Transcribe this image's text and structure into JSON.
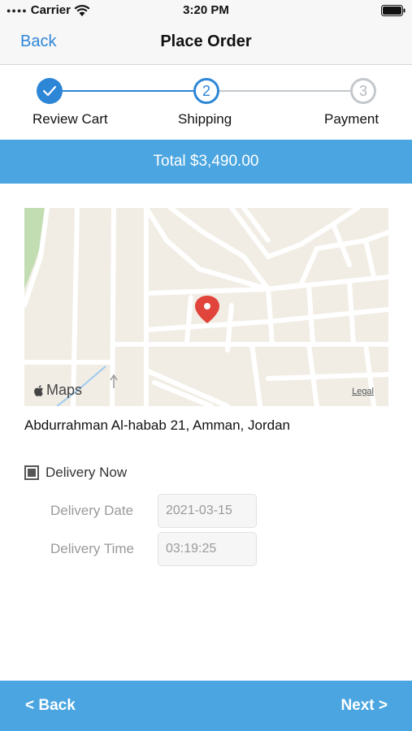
{
  "status_bar": {
    "carrier": "Carrier",
    "time": "3:20 PM"
  },
  "nav": {
    "back_label": "Back",
    "title": "Place Order"
  },
  "stepper": {
    "steps": [
      {
        "label": "Review Cart",
        "number": "1",
        "state": "done"
      },
      {
        "label": "Shipping",
        "number": "2",
        "state": "current"
      },
      {
        "label": "Payment",
        "number": "3",
        "state": "future"
      }
    ]
  },
  "total": {
    "text": "Total $3,490.00"
  },
  "map": {
    "brand": "Maps",
    "legal": "Legal"
  },
  "address": "Abdurrahman Al-habab 21, Amman, Jordan",
  "delivery": {
    "now_label": "Delivery Now",
    "now_checked": true,
    "date_label": "Delivery Date",
    "date_value": "2021-03-15",
    "time_label": "Delivery Time",
    "time_value": "03:19:25"
  },
  "footer": {
    "back_label": "< Back",
    "next_label": "Next >"
  },
  "colors": {
    "accent": "#2e86d6",
    "banner": "#4aa5e0",
    "pin": "#e0443a"
  }
}
